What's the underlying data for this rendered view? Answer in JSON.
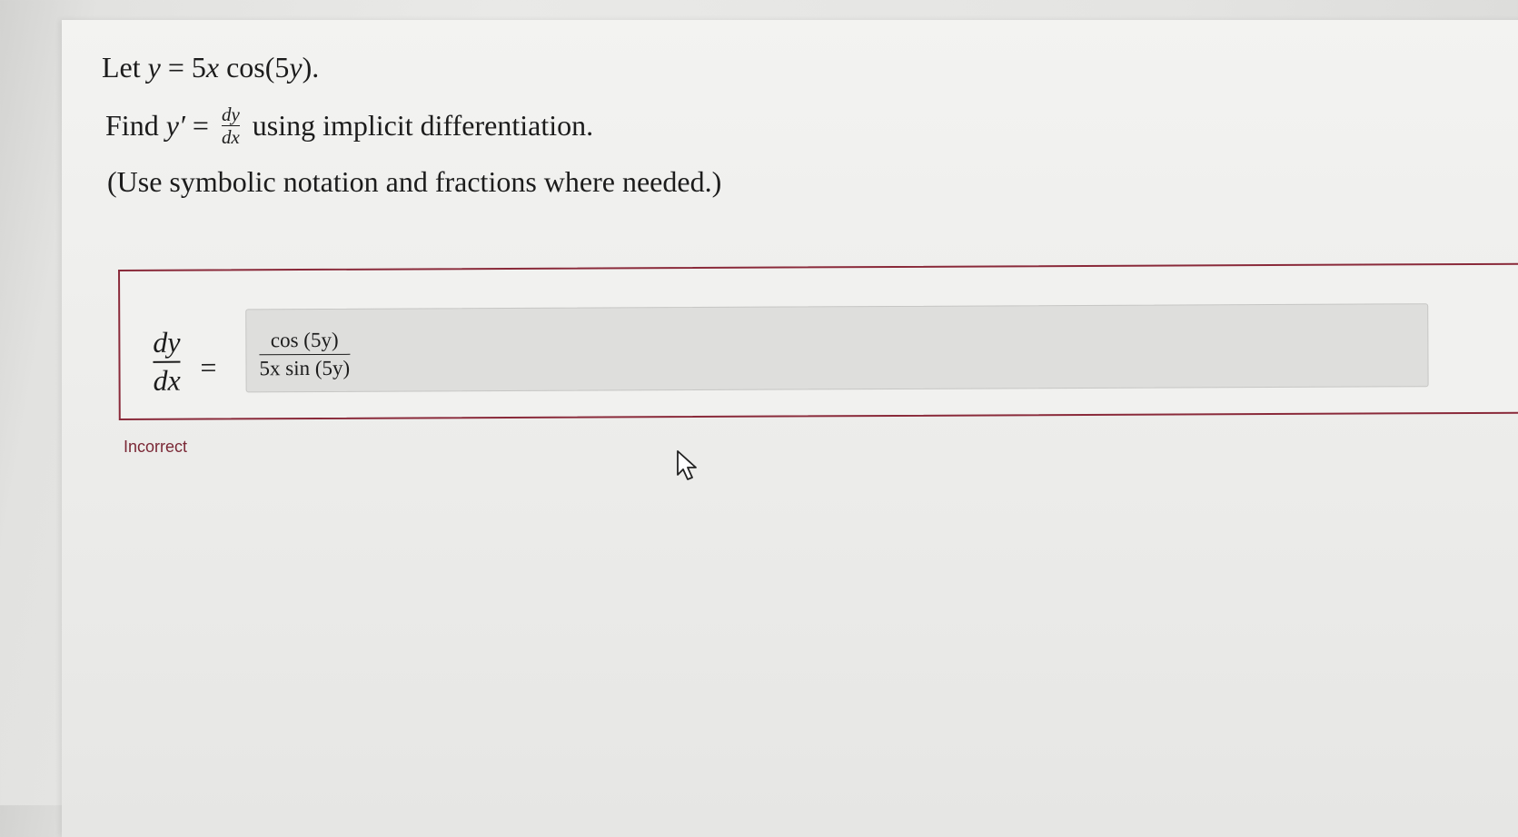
{
  "question": {
    "line1": {
      "prefix": "Let ",
      "lhs": "y",
      "equals": " = ",
      "coef": "5",
      "var_x": "x",
      "func": " cos(5",
      "inner": "y",
      "close": ")."
    },
    "line2": {
      "prefix": "Find ",
      "yprime": "y′",
      "equals": " = ",
      "frac_num": "dy",
      "frac_den": "dx",
      "suffix": " using implicit differentiation."
    },
    "line3": "(Use symbolic notation and fractions where needed.)"
  },
  "answer": {
    "label_num": "dy",
    "label_den": "dx",
    "equals": "=",
    "numerator": "cos (5y)",
    "denominator": "5x sin (5y)"
  },
  "feedback": {
    "status": "Incorrect",
    "status_color": "#7a2735",
    "border_color": "#8a2a3a"
  },
  "cursor_icon": "mouse-pointer-icon"
}
